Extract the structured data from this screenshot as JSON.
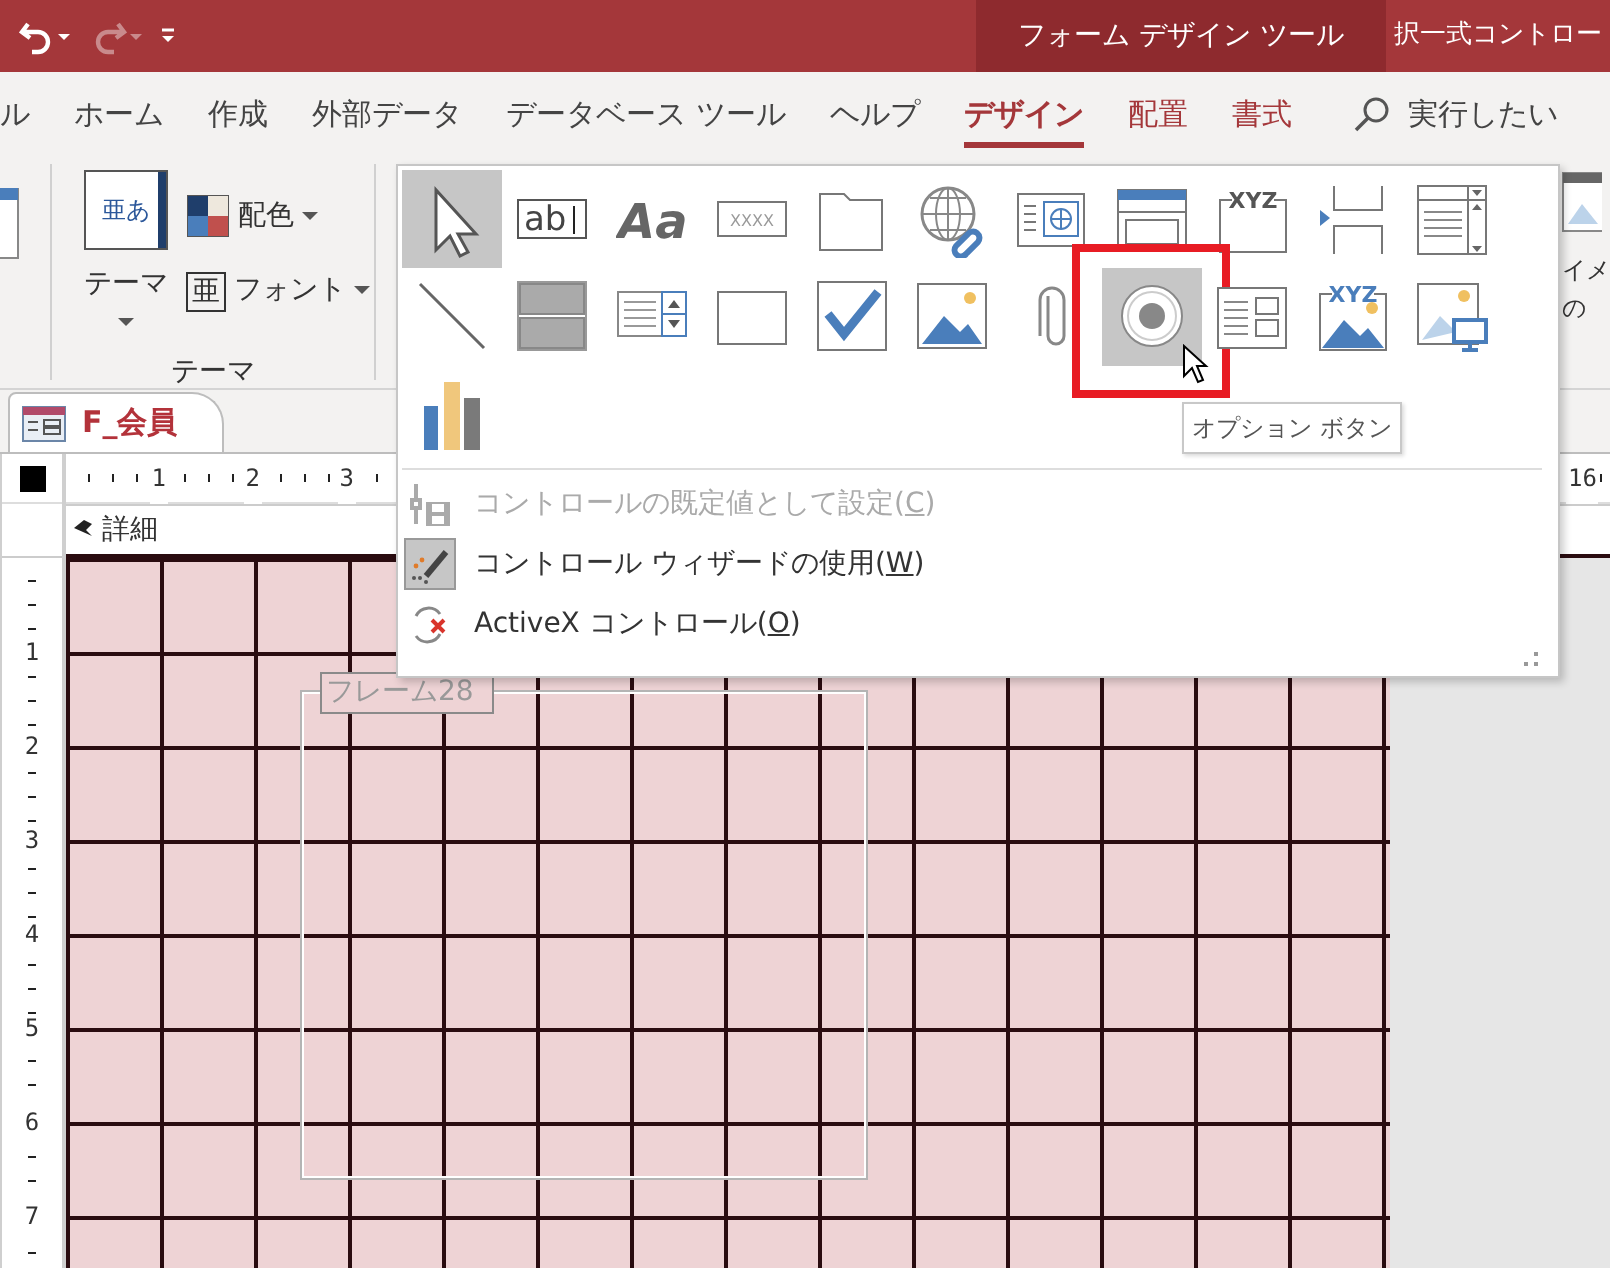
{
  "quick_access": [
    {
      "kind": "undo",
      "disabled": false
    },
    {
      "kind": "redo",
      "disabled": true
    },
    {
      "kind": "customize",
      "disabled": false
    }
  ],
  "context_tabs": [
    {
      "label": "フォーム デザイン ツール",
      "active": true
    },
    {
      "label": "択一式コントロー",
      "active": false
    }
  ],
  "ribbon_tabs": [
    {
      "label": "ル",
      "selected": false,
      "contextual": false
    },
    {
      "label": "ホーム",
      "selected": false,
      "contextual": false
    },
    {
      "label": "作成",
      "selected": false,
      "contextual": false
    },
    {
      "label": "外部データ",
      "selected": false,
      "contextual": false
    },
    {
      "label": "データベース ツール",
      "selected": false,
      "contextual": false
    },
    {
      "label": "ヘルプ",
      "selected": false,
      "contextual": false
    },
    {
      "label": "デザイン",
      "selected": true,
      "contextual": true
    },
    {
      "label": "配置",
      "selected": false,
      "contextual": true
    },
    {
      "label": "書式",
      "selected": false,
      "contextual": true
    }
  ],
  "search": {
    "placeholder": "実行したい"
  },
  "theme_group": {
    "theme_button": {
      "label": "テーマ",
      "glyph": "亜あ"
    },
    "colors_button": {
      "label": "配色"
    },
    "fonts_button": {
      "label": "フォント",
      "glyph": "亜"
    },
    "label": "テーマ"
  },
  "image_button": {
    "label_lines": [
      "イメ",
      "の"
    ]
  },
  "document_tab": {
    "title": "F_会員"
  },
  "horizontal_ruler": [
    "1",
    "2",
    "3",
    "16"
  ],
  "section": {
    "title": "詳細"
  },
  "vertical_ruler": [
    "1",
    "2",
    "3",
    "4",
    "5",
    "6",
    "7"
  ],
  "frame": {
    "label": "フレーム28"
  },
  "palette": {
    "controls": [
      {
        "kind": "select",
        "selected": true,
        "hovered": false,
        "highlighted": false
      },
      {
        "kind": "textbox",
        "glyph": "ab",
        "selected": false,
        "hovered": false,
        "highlighted": false
      },
      {
        "kind": "label",
        "glyph": "Aa",
        "selected": false,
        "hovered": false,
        "highlighted": false
      },
      {
        "kind": "button",
        "glyph": "XXXX",
        "selected": false,
        "hovered": false,
        "highlighted": false
      },
      {
        "kind": "tab",
        "selected": false,
        "hovered": false,
        "highlighted": false
      },
      {
        "kind": "hyperlink",
        "selected": false,
        "hovered": false,
        "highlighted": false
      },
      {
        "kind": "web",
        "selected": false,
        "hovered": false,
        "highlighted": false
      },
      {
        "kind": "navigation",
        "selected": false,
        "hovered": false,
        "highlighted": false
      },
      {
        "kind": "group",
        "glyph": "XYZ",
        "selected": false,
        "hovered": false,
        "highlighted": false
      },
      {
        "kind": "pagebreak",
        "selected": false,
        "hovered": false,
        "highlighted": false
      },
      {
        "kind": "combo",
        "selected": false,
        "hovered": false,
        "highlighted": false
      },
      {
        "kind": "line",
        "selected": false,
        "hovered": false,
        "highlighted": false
      },
      {
        "kind": "toggle",
        "selected": false,
        "hovered": false,
        "highlighted": false
      },
      {
        "kind": "listbox",
        "selected": false,
        "hovered": false,
        "highlighted": false
      },
      {
        "kind": "rect",
        "selected": false,
        "hovered": false,
        "highlighted": false
      },
      {
        "kind": "checkbox",
        "selected": false,
        "hovered": false,
        "highlighted": false
      },
      {
        "kind": "image",
        "selected": false,
        "hovered": false,
        "highlighted": false
      },
      {
        "kind": "attachment",
        "selected": false,
        "hovered": false,
        "highlighted": false
      },
      {
        "kind": "option",
        "selected": false,
        "hovered": true,
        "highlighted": true
      },
      {
        "kind": "subform",
        "selected": false,
        "hovered": false,
        "highlighted": false
      },
      {
        "kind": "bound",
        "glyph": "XYZ",
        "selected": false,
        "hovered": false,
        "highlighted": false
      },
      {
        "kind": "unbound",
        "selected": false,
        "hovered": false,
        "highlighted": false
      },
      {
        "kind": "chart",
        "selected": false,
        "hovered": false,
        "highlighted": false
      }
    ],
    "tooltip": "オプション ボタン",
    "menu": [
      {
        "kind": "set-default",
        "label_parts": [
          "コントロールの既定値として設定(",
          "C",
          ")"
        ],
        "disabled": true,
        "checked": false
      },
      {
        "kind": "wizard",
        "label_parts": [
          "コントロール ウィザードの使用(",
          "W",
          ")"
        ],
        "disabled": false,
        "checked": true
      },
      {
        "kind": "activex",
        "label_parts": [
          "ActiveX コントロール(",
          "O",
          ")"
        ],
        "disabled": false,
        "checked": false
      }
    ]
  }
}
